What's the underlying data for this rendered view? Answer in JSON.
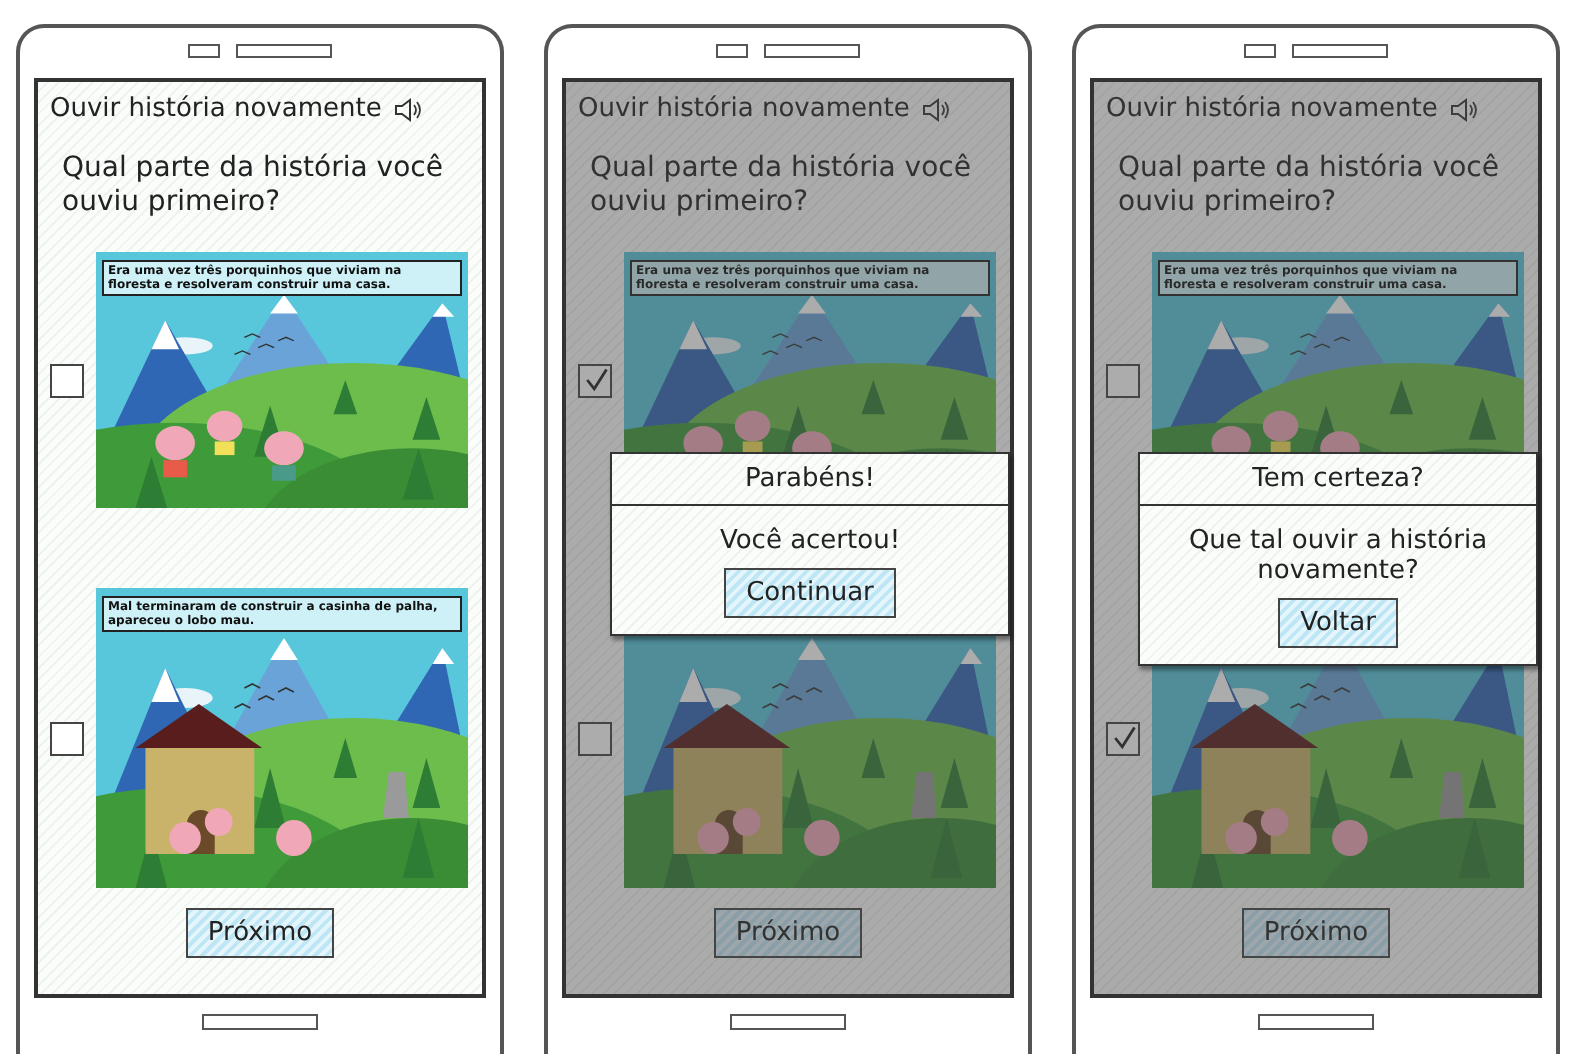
{
  "screens": [
    {
      "title": "Ouvir história novamente",
      "question": "Qual parte da história você ouviu primeiro?",
      "options": [
        {
          "kind": "pigs",
          "caption": "Era uma vez três porquinhos que viviam na floresta e resolveram construir uma casa.",
          "checked": false
        },
        {
          "kind": "house",
          "caption": "Mal terminaram de construir a casinha de palha, apareceu o lobo mau.",
          "checked": false
        }
      ],
      "next_button": "Próximo"
    },
    {
      "title": "Ouvir história novamente",
      "question": "Qual parte da história você ouviu primeiro?",
      "options": [
        {
          "kind": "pigs",
          "caption": "Era uma vez três porquinhos que viviam na floresta e resolveram construir uma casa.",
          "checked": true
        },
        {
          "kind": "house",
          "checked": false
        }
      ],
      "next_button": "Próximo",
      "dialog": {
        "title": "Parabéns!",
        "message": "Você acertou!",
        "button": "Continuar"
      }
    },
    {
      "title": "Ouvir história novamente",
      "question": "Qual parte da história você ouviu primeiro?",
      "options": [
        {
          "kind": "pigs",
          "caption": "Era uma vez três porquinhos que viviam na floresta e resolveram construir uma casa.",
          "checked": false
        },
        {
          "kind": "house",
          "checked": true
        }
      ],
      "next_button": "Próximo",
      "dialog": {
        "title": "Tem certeza?",
        "message": "Que tal ouvir a história novamente?",
        "button": "Voltar"
      }
    }
  ]
}
